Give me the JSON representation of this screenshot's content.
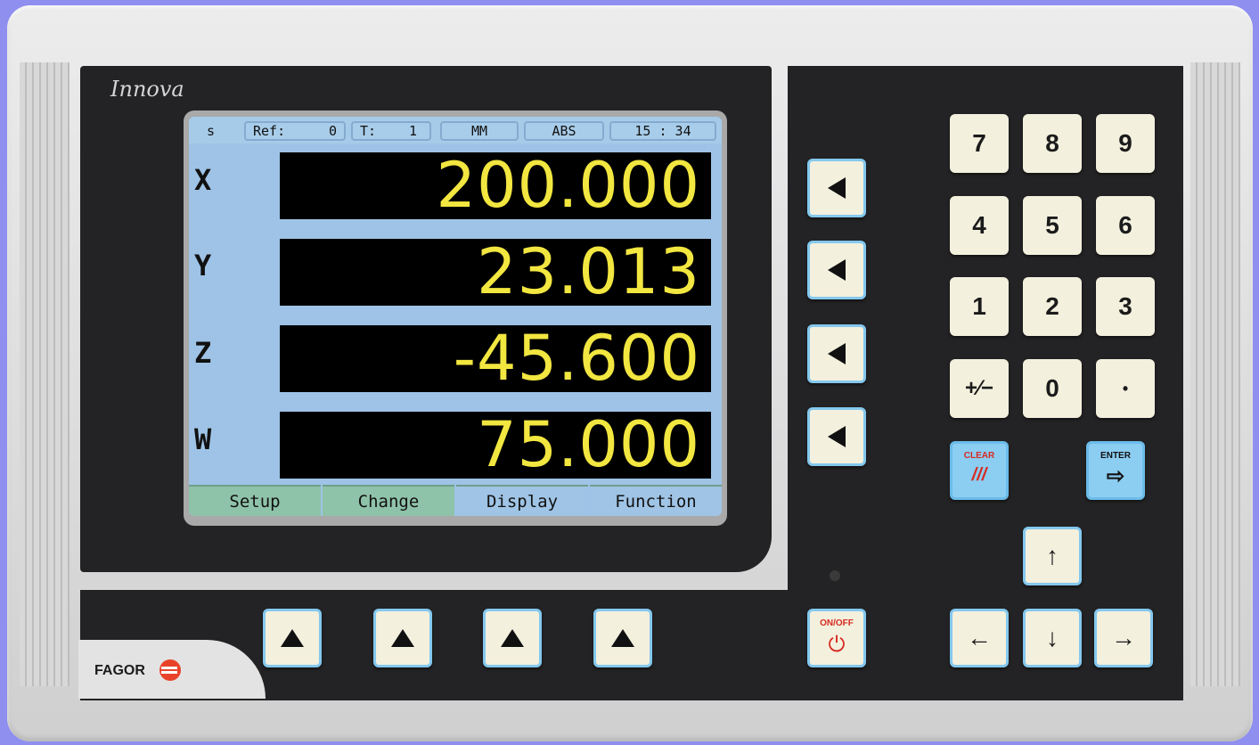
{
  "brand": {
    "model": "Innova",
    "maker": "FAGOR"
  },
  "status_bar": {
    "mode": "s",
    "ref_label": "Ref:",
    "ref_value": "0",
    "tool_label": "T:",
    "tool_value": "1",
    "units": "MM",
    "coords": "ABS",
    "time": "15 : 34"
  },
  "axes": [
    {
      "letter": "X",
      "value": "200.000"
    },
    {
      "letter": "Y",
      "value": "23.013"
    },
    {
      "letter": "Z",
      "value": "-45.600"
    },
    {
      "letter": "W",
      "value": "75.000"
    }
  ],
  "softkeys": [
    "Setup",
    "Change",
    "Display",
    "Function"
  ],
  "keypad": {
    "digits": [
      "7",
      "8",
      "9",
      "4",
      "5",
      "6",
      "1",
      "2",
      "3"
    ],
    "plus_minus": "+⁄−",
    "zero": "0",
    "dot": "•",
    "clear_label": "CLEAR",
    "clear_symbol": "///",
    "enter_label": "ENTER",
    "enter_symbol": "⇨",
    "arrow_up": "↑",
    "arrow_down": "↓",
    "arrow_left": "←",
    "arrow_right": "→"
  },
  "power": {
    "label": "ON/OFF",
    "symbol": "⏻"
  },
  "colors": {
    "lcd_background": "#9ec3e6",
    "readout_text": "#f2e640",
    "softkey_green": "#8fc3a9",
    "key_face": "#f3f0de",
    "key_border": "#84c8ee",
    "panel": "#232325"
  }
}
